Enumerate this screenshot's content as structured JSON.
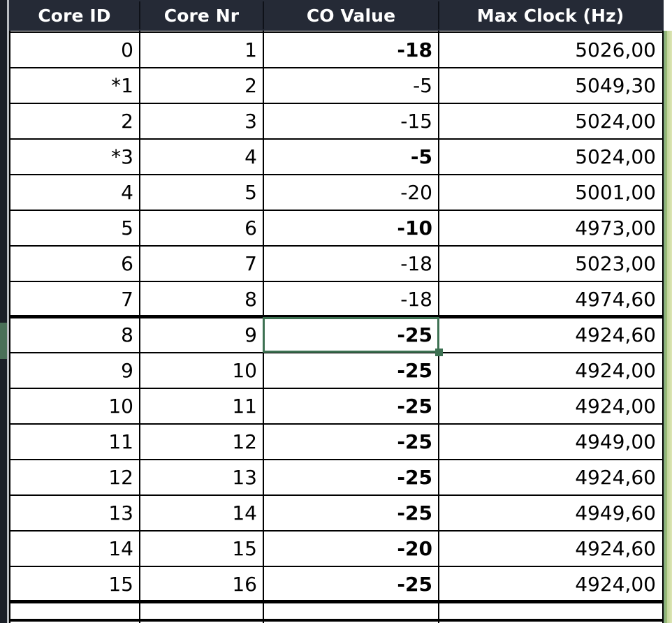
{
  "table": {
    "columns": [
      "Core ID",
      "Core Nr",
      "CO Value",
      "Max Clock (Hz)"
    ],
    "rows": [
      {
        "core_id": "0",
        "core_nr": "1",
        "co_value": "-18",
        "co_bold": true,
        "max_clock": "5026,00"
      },
      {
        "core_id": "*1",
        "core_nr": "2",
        "co_value": "-5",
        "co_bold": false,
        "max_clock": "5049,30"
      },
      {
        "core_id": "2",
        "core_nr": "3",
        "co_value": "-15",
        "co_bold": false,
        "max_clock": "5024,00"
      },
      {
        "core_id": "*3",
        "core_nr": "4",
        "co_value": "-5",
        "co_bold": true,
        "max_clock": "5024,00"
      },
      {
        "core_id": "4",
        "core_nr": "5",
        "co_value": "-20",
        "co_bold": false,
        "max_clock": "5001,00"
      },
      {
        "core_id": "5",
        "core_nr": "6",
        "co_value": "-10",
        "co_bold": true,
        "max_clock": "4973,00"
      },
      {
        "core_id": "6",
        "core_nr": "7",
        "co_value": "-18",
        "co_bold": false,
        "max_clock": "5023,00"
      },
      {
        "core_id": "7",
        "core_nr": "8",
        "co_value": "-18",
        "co_bold": false,
        "max_clock": "4974,60"
      },
      {
        "core_id": "8",
        "core_nr": "9",
        "co_value": "-25",
        "co_bold": true,
        "max_clock": "4924,60"
      },
      {
        "core_id": "9",
        "core_nr": "10",
        "co_value": "-25",
        "co_bold": true,
        "max_clock": "4924,00"
      },
      {
        "core_id": "10",
        "core_nr": "11",
        "co_value": "-25",
        "co_bold": true,
        "max_clock": "4924,00"
      },
      {
        "core_id": "11",
        "core_nr": "12",
        "co_value": "-25",
        "co_bold": true,
        "max_clock": "4949,00"
      },
      {
        "core_id": "12",
        "core_nr": "13",
        "co_value": "-25",
        "co_bold": true,
        "max_clock": "4924,60"
      },
      {
        "core_id": "13",
        "core_nr": "14",
        "co_value": "-25",
        "co_bold": true,
        "max_clock": "4949,60"
      },
      {
        "core_id": "14",
        "core_nr": "15",
        "co_value": "-20",
        "co_bold": true,
        "max_clock": "4924,60"
      },
      {
        "core_id": "15",
        "core_nr": "16",
        "co_value": "-25",
        "co_bold": true,
        "max_clock": "4924,00"
      }
    ],
    "thick_row_separators": [
      8,
      16
    ]
  },
  "selection": {
    "row_index": 8,
    "column_index": 2,
    "column_label": "CO Value",
    "value": "-25"
  },
  "colors": {
    "header_background": "#252a36",
    "header_text": "#ffffff",
    "grid_line": "#000000",
    "cell_text": "#000000",
    "selection_border": "#3d7152",
    "row_header_background": "#1b1f27",
    "row_header_selected": "#4a7058"
  }
}
